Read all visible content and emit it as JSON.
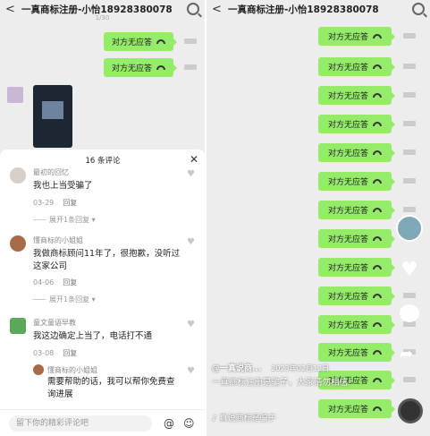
{
  "left": {
    "header_title": "一真商标注册-小怡18928380078",
    "header_sub": "1/30",
    "bubble_text": "对方无应答",
    "comments_header": "16 条评论",
    "comments": [
      {
        "name": "最初的回忆",
        "text": "我也上当受骗了",
        "date": "03-29",
        "reply": "回复",
        "expand": "展开1条回复"
      },
      {
        "name": "懂商标的小姐姐",
        "text": "我做商标顾问11年了，很抱歉，没听过这家公司",
        "date": "04-06",
        "reply": "回复",
        "expand": "展开1条回复"
      },
      {
        "name": "童文童语早教",
        "text": "我这边确定上当了，电话打不通",
        "date": "03-08",
        "reply": "回复"
      },
      {
        "name": "懂商标的小姐姐",
        "text": "需要帮助的话，我可以帮你免费查询进展"
      }
    ],
    "input_placeholder": "留下你的精彩评论吧",
    "at_icon": "@",
    "emoji_icon": "☺"
  },
  "right": {
    "header_title": "一真商标注册-小怡18928380078",
    "bubble_text": "对方无应答",
    "author": "@一真说商...",
    "date": "2023年02月12日",
    "caption": "一真商标注册是骗子，大家请勿相信!",
    "music": "真说商标是骗子",
    "music_symbol": "♪"
  },
  "colors": {
    "bubble": "#95ec69",
    "bg": "#ededed"
  }
}
